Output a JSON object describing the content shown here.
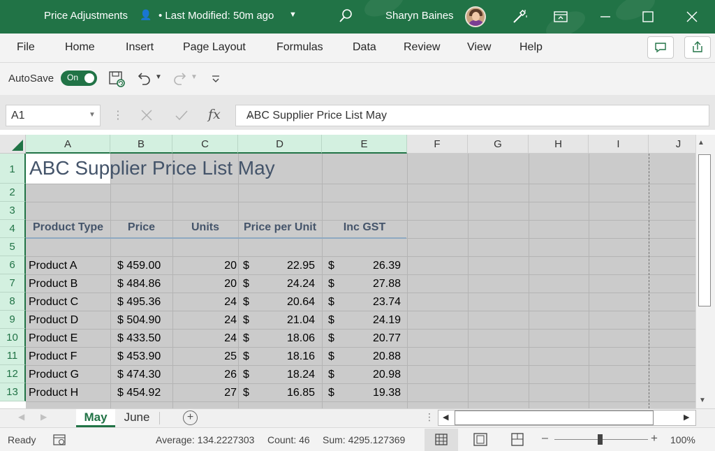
{
  "titlebar": {
    "doc_title": "Price Adjustments",
    "modified": "• Last Modified: 50m ago",
    "user_name": "Sharyn Baines",
    "accent": "#217346"
  },
  "menu": {
    "items": [
      "File",
      "Home",
      "Insert",
      "Page Layout",
      "Formulas",
      "Data",
      "Review",
      "View",
      "Help"
    ]
  },
  "qat": {
    "autosave_label": "AutoSave",
    "autosave_state": "On"
  },
  "formula_bar": {
    "name_box": "A1",
    "fx": "fx",
    "content": "ABC Supplier Price List May"
  },
  "grid": {
    "columns": [
      "A",
      "B",
      "C",
      "D",
      "E",
      "F",
      "G",
      "H",
      "I",
      "J"
    ],
    "row_numbers": [
      "1",
      "2",
      "3",
      "4",
      "5",
      "6",
      "7",
      "8",
      "9",
      "10",
      "11",
      "12",
      "13"
    ],
    "title": "ABC Supplier Price List May",
    "headers": [
      "Product Type",
      "Price",
      "Units",
      "Price per Unit",
      "Inc GST"
    ],
    "rows": [
      {
        "product": "Product A",
        "price": "$ 459.00",
        "units": "20",
        "ppu": "22.95",
        "gst": "26.39"
      },
      {
        "product": "Product B",
        "price": "$ 484.86",
        "units": "20",
        "ppu": "24.24",
        "gst": "27.88"
      },
      {
        "product": "Product C",
        "price": "$ 495.36",
        "units": "24",
        "ppu": "20.64",
        "gst": "23.74"
      },
      {
        "product": "Product D",
        "price": "$ 504.90",
        "units": "24",
        "ppu": "21.04",
        "gst": "24.19"
      },
      {
        "product": "Product E",
        "price": "$ 433.50",
        "units": "24",
        "ppu": "18.06",
        "gst": "20.77"
      },
      {
        "product": "Product F",
        "price": "$ 453.90",
        "units": "25",
        "ppu": "18.16",
        "gst": "20.88"
      },
      {
        "product": "Product G",
        "price": "$ 474.30",
        "units": "26",
        "ppu": "18.24",
        "gst": "20.98"
      },
      {
        "product": "Product H",
        "price": "$ 454.92",
        "units": "27",
        "ppu": "16.85",
        "gst": "19.38"
      }
    ],
    "currency_symbol": "$"
  },
  "sheets": {
    "tabs": [
      "May",
      "June"
    ],
    "active": "May"
  },
  "status": {
    "ready": "Ready",
    "average": "Average: 134.2227303",
    "count": "Count: 46",
    "sum": "Sum: 4295.127369",
    "zoom": "100%"
  }
}
